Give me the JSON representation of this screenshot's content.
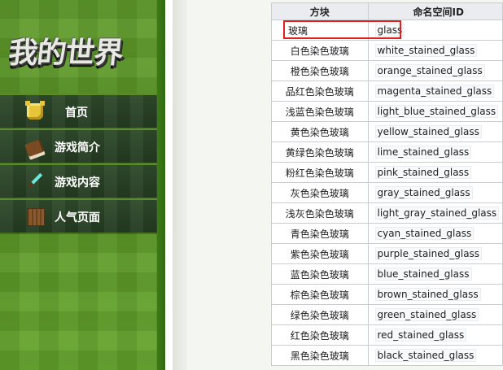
{
  "site": {
    "logo_text": "我的世界"
  },
  "nav": [
    {
      "label": "首页",
      "icon": "armor-icon"
    },
    {
      "label": "游戏简介",
      "icon": "book-icon"
    },
    {
      "label": "游戏内容",
      "icon": "sword-icon"
    },
    {
      "label": "人气页面",
      "icon": "crafting-table-icon"
    }
  ],
  "table": {
    "headers": [
      "方块",
      "命名空间ID"
    ],
    "rows": [
      {
        "name": "玻璃",
        "id": "glass",
        "highlighted": true
      },
      {
        "name": "白色染色玻璃",
        "id": "white_stained_glass"
      },
      {
        "name": "橙色染色玻璃",
        "id": "orange_stained_glass"
      },
      {
        "name": "品红色染色玻璃",
        "id": "magenta_stained_glass"
      },
      {
        "name": "浅蓝色染色玻璃",
        "id": "light_blue_stained_glass"
      },
      {
        "name": "黄色染色玻璃",
        "id": "yellow_stained_glass"
      },
      {
        "name": "黄绿色染色玻璃",
        "id": "lime_stained_glass"
      },
      {
        "name": "粉红色染色玻璃",
        "id": "pink_stained_glass"
      },
      {
        "name": "灰色染色玻璃",
        "id": "gray_stained_glass"
      },
      {
        "name": "浅灰色染色玻璃",
        "id": "light_gray_stained_glass"
      },
      {
        "name": "青色染色玻璃",
        "id": "cyan_stained_glass"
      },
      {
        "name": "紫色染色玻璃",
        "id": "purple_stained_glass"
      },
      {
        "name": "蓝色染色玻璃",
        "id": "blue_stained_glass"
      },
      {
        "name": "棕色染色玻璃",
        "id": "brown_stained_glass"
      },
      {
        "name": "绿色染色玻璃",
        "id": "green_stained_glass"
      },
      {
        "name": "红色染色玻璃",
        "id": "red_stained_glass"
      },
      {
        "name": "黑色染色玻璃",
        "id": "black_stained_glass"
      }
    ]
  },
  "colors": {
    "highlight_border": "#e0201b",
    "sidebar_green": "#5f9a2a",
    "nav_dark": "#2f4a2b"
  }
}
